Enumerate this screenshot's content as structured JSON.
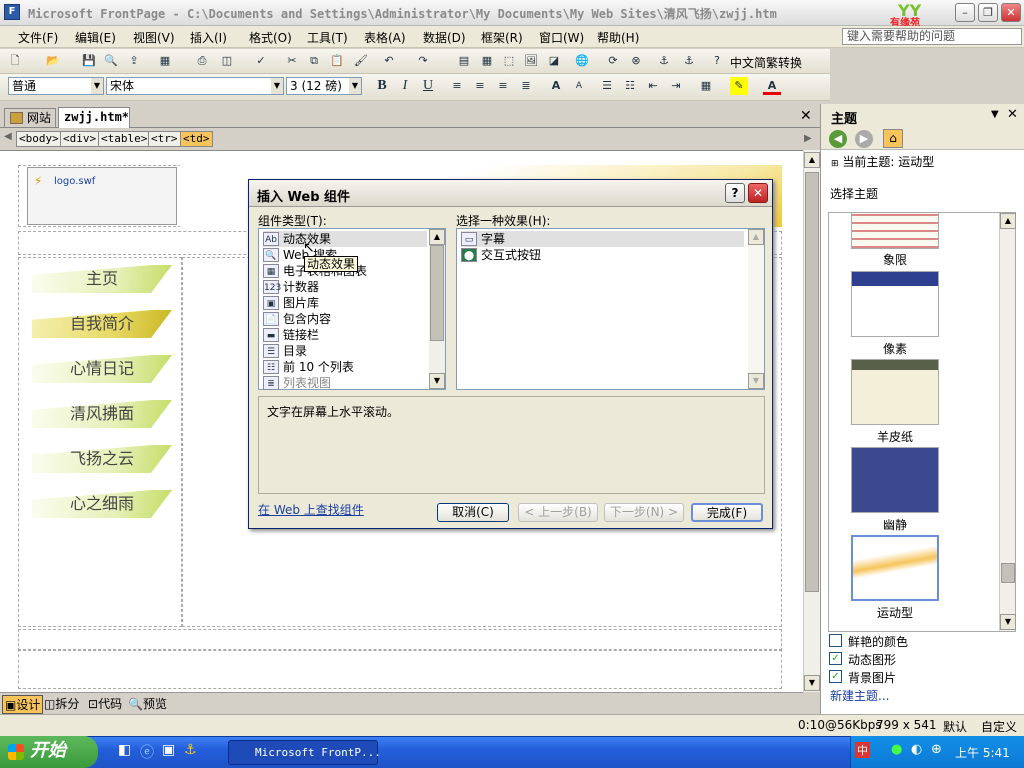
{
  "window": {
    "title": "Microsoft FrontPage - C:\\Documents and Settings\\Administrator\\My Documents\\My Web Sites\\清风飞扬\\zwjj.htm",
    "logo_text": "有缘苑"
  },
  "menu": {
    "items": [
      "文件(F)",
      "编辑(E)",
      "视图(V)",
      "插入(I)",
      "格式(O)",
      "工具(T)",
      "表格(A)",
      "数据(D)",
      "框架(R)",
      "窗口(W)",
      "帮助(H)"
    ],
    "help_placeholder": "键入需要帮助的问题"
  },
  "toolbar": {
    "chinese_convert_label": "中文简繁转换",
    "style_value": "普通",
    "font_value": "宋体",
    "size_value": "3 (12 磅)"
  },
  "doc_tabs": {
    "site_tab": "网站",
    "file_tab": "zwjj.htm*"
  },
  "tag_path": [
    "<body>",
    "<div>",
    "<table>",
    "<tr>",
    "<td>"
  ],
  "editor": {
    "logo_file": "logo.swf",
    "nav_items": [
      "主页",
      "自我简介",
      "心情日记",
      "清风拂面",
      "飞扬之云",
      "心之细雨"
    ],
    "active_nav_index": 1
  },
  "view_tabs": [
    "设计",
    "拆分",
    "代码",
    "预览"
  ],
  "status": {
    "connection": "0:10@56Kbps",
    "dimensions": "799 x 541",
    "mode": "默认",
    "custom": "自定义"
  },
  "theme_panel": {
    "title": "主题",
    "current_label": "当前主题: 运动型",
    "select_label": "选择主题",
    "themes": [
      "象限",
      "像素",
      "羊皮纸",
      "幽静",
      "运动型"
    ],
    "options": [
      {
        "label": "鲜艳的颜色",
        "checked": false
      },
      {
        "label": "动态图形",
        "checked": true
      },
      {
        "label": "背景图片",
        "checked": true
      }
    ],
    "new_theme_link": "新建主题..."
  },
  "dialog": {
    "title": "插入 Web 组件",
    "component_type_label": "组件类型(T):",
    "effect_label": "选择一种效果(H):",
    "components": [
      "动态效果",
      "Web 搜索",
      "电子表格和图表",
      "计数器",
      "图片库",
      "包含内容",
      "链接栏",
      "目录",
      "前 10 个列表",
      "列表视图"
    ],
    "effects": [
      "字幕",
      "交互式按钮"
    ],
    "description": "文字在屏幕上水平滚动。",
    "find_link": "在 Web 上查找组件",
    "buttons": {
      "cancel": "取消(C)",
      "back": "< 上一步(B)",
      "next": "下一步(N) >",
      "finish": "完成(F)"
    },
    "tooltip": "动态效果"
  },
  "taskbar": {
    "start_label": "开始",
    "task_button": "Microsoft FrontP...",
    "time": "上午 5:41"
  }
}
